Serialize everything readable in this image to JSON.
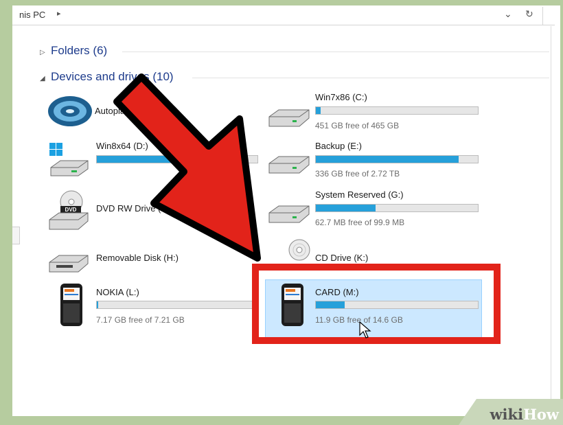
{
  "address": {
    "crumb": "nis PC",
    "refresh_glyph": "↻"
  },
  "groups": {
    "folders": {
      "label": "Folders (6)"
    },
    "devices": {
      "label": "Devices and drives (10)"
    }
  },
  "devices": [
    {
      "name": "Autoplay",
      "icon": "blu-ray-icon",
      "free_text": ""
    },
    {
      "name": "Win8x64 (D:)",
      "icon": "windows-drive-icon",
      "free_text": "",
      "used_fraction": 0.55
    },
    {
      "name": "DVD RW Drive (F:)",
      "icon": "dvd-drive-icon",
      "free_text": ""
    },
    {
      "name": "Removable Disk (H:)",
      "icon": "removable-disk-icon",
      "free_text": ""
    },
    {
      "name": "NOKIA (L:)",
      "icon": "phone-icon",
      "free_text": "7.17 GB free of 7.21 GB",
      "used_fraction": 0.01
    },
    {
      "name": "Win7x86 (C:)",
      "icon": "hard-drive-icon",
      "free_text": "451 GB free of 465 GB",
      "used_fraction": 0.03
    },
    {
      "name": "Backup (E:)",
      "icon": "hard-drive-icon",
      "free_text": "336 GB free of 2.72 TB",
      "used_fraction": 0.88
    },
    {
      "name": "System Reserved (G:)",
      "icon": "hard-drive-icon",
      "free_text": "62.7 MB free of 99.9 MB",
      "used_fraction": 0.37
    },
    {
      "name": "CD Drive (K:)",
      "icon": "cd-drive-icon",
      "free_text": ""
    },
    {
      "name": "CARD (M:)",
      "icon": "phone-icon",
      "free_text": "11.9 GB free of 14.6 GB",
      "used_fraction": 0.18
    }
  ],
  "watermark": {
    "part1": "wiki",
    "part2": "How"
  },
  "colors": {
    "bar_fill": "#26a0da",
    "highlight_red": "#e2231a",
    "selection": "#cce8ff",
    "background": "#b6cc9f"
  }
}
